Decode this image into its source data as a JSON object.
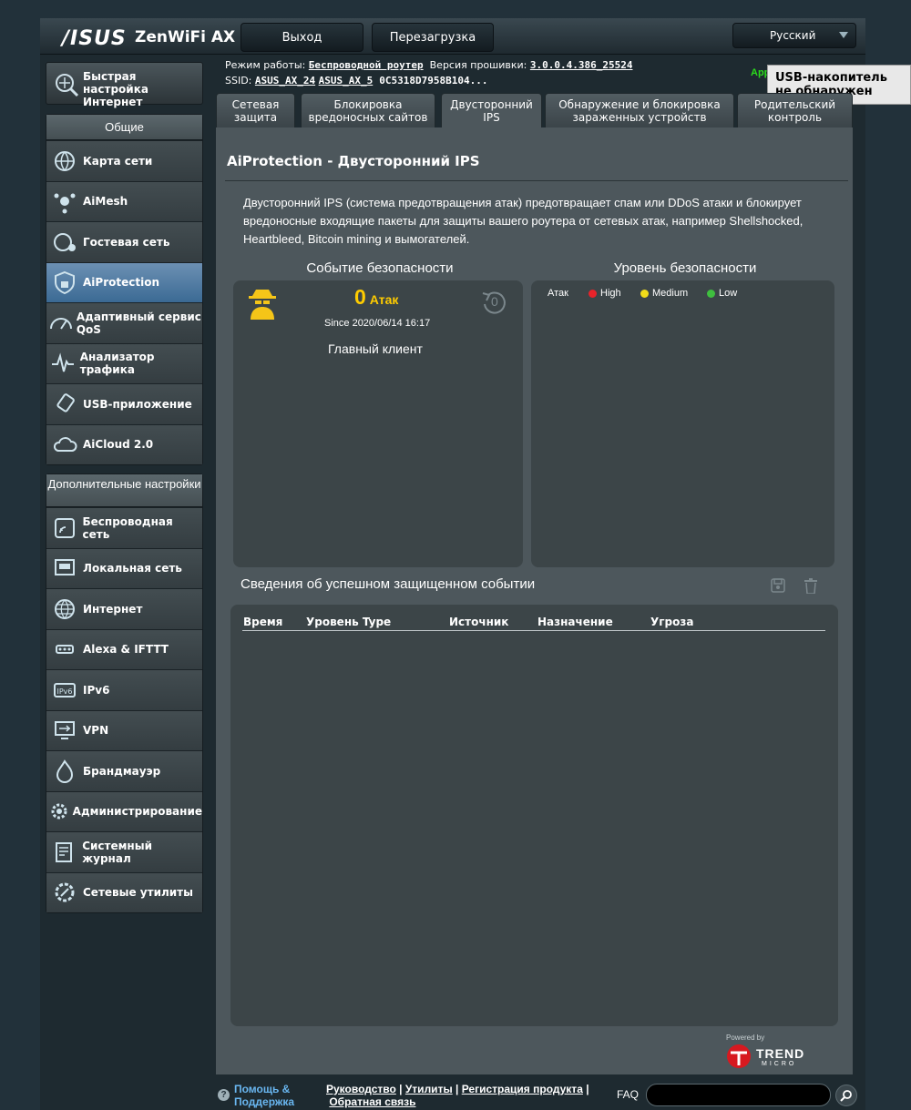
{
  "header": {
    "brand": "/ISUS",
    "model": "ZenWiFi AX",
    "logout_label": "Выход",
    "reboot_label": "Перезагрузка",
    "language": "Русский"
  },
  "status": {
    "mode_label": "Режим работы:",
    "mode_value": "Беспроводной роутер",
    "firmware_label": "Версия прошивки:",
    "firmware_value": "3.0.0.4.386_25524",
    "ssid_label": "SSID:",
    "ssid_1": "ASUS_AX_24",
    "ssid_2": "ASUS_AX_5",
    "ssid_3": "0C5318D7958B104...",
    "app_label": "App",
    "usb_tooltip": "USB-накопитель не обнаружен"
  },
  "sidebar": {
    "quick_setup": "Быстрая настройка Интернет",
    "general_header": "Общие",
    "general_items": [
      {
        "label": "Карта сети",
        "icon": "globe-network-icon"
      },
      {
        "label": "AiMesh",
        "icon": "aimesh-icon"
      },
      {
        "label": "Гостевая сеть",
        "icon": "guest-network-icon"
      },
      {
        "label": "AiProtection",
        "icon": "shield-lock-icon"
      },
      {
        "label": "Адаптивный сервис QoS",
        "icon": "speedometer-icon"
      },
      {
        "label": "Анализатор трафика",
        "icon": "traffic-wave-icon"
      },
      {
        "label": "USB-приложение",
        "icon": "usb-icon"
      },
      {
        "label": "AiCloud 2.0",
        "icon": "cloud-icon"
      }
    ],
    "advanced_header": "Дополнительные настройки",
    "advanced_items": [
      {
        "label": "Беспроводная сеть",
        "icon": "wireless-icon"
      },
      {
        "label": "Локальная сеть",
        "icon": "lan-port-icon"
      },
      {
        "label": "Интернет",
        "icon": "globe-icon"
      },
      {
        "label": "Alexa & IFTTT",
        "icon": "alexa-icon"
      },
      {
        "label": "IPv6",
        "icon": "ipv6-icon"
      },
      {
        "label": "VPN",
        "icon": "vpn-icon"
      },
      {
        "label": "Брандмауэр",
        "icon": "firewall-icon"
      },
      {
        "label": "Администрирование",
        "icon": "gear-user-icon"
      },
      {
        "label": "Системный журнал",
        "icon": "log-icon"
      },
      {
        "label": "Сетевые утилиты",
        "icon": "tools-icon"
      }
    ]
  },
  "tabs": [
    {
      "label": "Сетевая защита"
    },
    {
      "label": "Блокировка вредоносных сайтов"
    },
    {
      "label": "Двусторонний IPS"
    },
    {
      "label": "Обнаружение и блокировка зараженных устройств"
    },
    {
      "label": "Родительский контроль"
    }
  ],
  "main": {
    "title": "AiProtection - Двусторонний IPS",
    "description": "Двусторонний IPS (система предотвращения атак) предотвращает спам или DDoS атаки и блокирует вредоносные входящие пакеты для защиты вашего роутера от сетевых атак, например Shellshocked, Heartbleed, Bitcoin mining и вымогателей.",
    "security_event_title": "Событие безопасности",
    "security_level_title": "Уровень безопасности",
    "attack_count": "0",
    "attack_unit": "Атак",
    "since": "Since 2020/06/14 16:17",
    "reset_count": "0",
    "main_client": "Главный клиент",
    "legend_label": "Атак",
    "legend": [
      {
        "name": "High",
        "color": "#e8232a"
      },
      {
        "name": "Medium",
        "color": "#f1dc1a"
      },
      {
        "name": "Low",
        "color": "#3fbf3f"
      }
    ],
    "events_title": "Сведения об успешном защищенном событии",
    "table_headers": [
      "Время",
      "Уровень Type",
      "Источник",
      "Назначение",
      "Угроза"
    ],
    "powered_by": "Powered by",
    "trend_brand": "TREND",
    "trend_sub": "MICRO"
  },
  "footer": {
    "help": "Помощь & Поддержка",
    "link_manual": "Руководство",
    "link_utils": "Утилиты",
    "link_register": "Регистрация продукта",
    "link_feedback": "Обратная связь",
    "faq": "FAQ"
  }
}
